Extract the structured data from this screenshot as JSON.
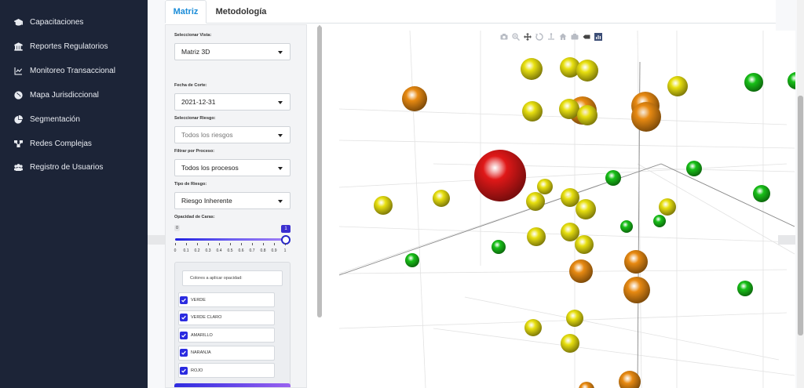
{
  "sidebar": {
    "items": [
      {
        "label": "Capacitaciones",
        "icon": "graduation-cap-icon"
      },
      {
        "label": "Reportes Regulatorios",
        "icon": "bank-icon"
      },
      {
        "label": "Monitoreo Transaccional",
        "icon": "line-chart-icon"
      },
      {
        "label": "Mapa Jurisdiccional",
        "icon": "globe-icon"
      },
      {
        "label": "Segmentación",
        "icon": "pie-chart-icon"
      },
      {
        "label": "Redes Complejas",
        "icon": "network-icon"
      },
      {
        "label": "Registro de Usuarios",
        "icon": "users-icon"
      }
    ]
  },
  "tabs": [
    {
      "label": "Matriz",
      "active": true
    },
    {
      "label": "Metodología",
      "active": false
    }
  ],
  "controls": {
    "vista": {
      "label": "Seleccionar Vista:",
      "value": "Matriz 3D"
    },
    "fecha": {
      "label": "Fecha de Corte:",
      "value": "2021-12-31"
    },
    "riesgo": {
      "label": "Seleccionar Riesgo:",
      "placeholder": "Todos los riesgos"
    },
    "proceso": {
      "label": "Filtrar por Proceso:",
      "value": "Todos los procesos"
    },
    "tipo": {
      "label": "Tipo de Riesgo:",
      "value": "Riesgo Inherente"
    },
    "opacidad": {
      "label": "Opacidad de Caras:",
      "min_label": "0",
      "value_label": "1",
      "value": 1,
      "ticks": [
        "0",
        "0.1",
        "0.2",
        "0.3",
        "0.4",
        "0.5",
        "0.6",
        "0.7",
        "0.8",
        "0.9",
        "1"
      ]
    },
    "colores": {
      "title": "Colores a aplicar opacidad:",
      "options": [
        {
          "label": "VERDE",
          "checked": true
        },
        {
          "label": "VERDE CLARO",
          "checked": true
        },
        {
          "label": "AMARILLO",
          "checked": true
        },
        {
          "label": "NARANJA",
          "checked": true
        },
        {
          "label": "ROJO",
          "checked": true
        }
      ]
    }
  },
  "modebar": [
    "camera-icon",
    "zoom-icon",
    "pan-icon",
    "orbit-icon",
    "turntable-icon",
    "home-icon",
    "reset-camera-icon",
    "hover-toggle-icon",
    "plotly-logo-icon"
  ],
  "colors": {
    "rojo": "#e01818",
    "naranja": "#e88a12",
    "amarillo": "#e8e010",
    "verde": "#18c018"
  },
  "chart_data": {
    "type": "scatter",
    "projection": "3d",
    "grid": true,
    "title": "",
    "series": [
      {
        "color": "rojo",
        "count": 1
      },
      {
        "color": "naranja",
        "count": 9
      },
      {
        "color": "amarillo",
        "count": 25
      },
      {
        "color": "verde",
        "count": 12
      }
    ]
  }
}
